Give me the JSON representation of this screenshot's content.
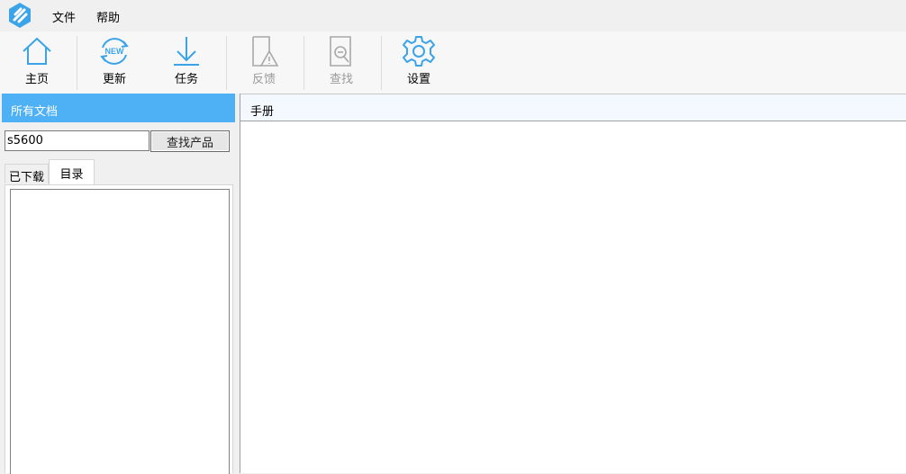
{
  "menu": {
    "items": [
      "文件",
      "帮助"
    ]
  },
  "toolbar": {
    "buttons": [
      {
        "label": "主页",
        "icon": "home-icon",
        "enabled": true
      },
      {
        "label": "更新",
        "icon": "new-update-icon",
        "badge": "NEW",
        "enabled": true
      },
      {
        "label": "任务",
        "icon": "download-arrow-icon",
        "enabled": true
      },
      {
        "label": "反馈",
        "icon": "feedback-warning-icon",
        "enabled": false
      },
      {
        "label": "查找",
        "icon": "search-document-icon",
        "enabled": false
      },
      {
        "label": "设置",
        "icon": "gear-icon",
        "enabled": true
      }
    ]
  },
  "left_panel": {
    "title": "所有文档",
    "search_value": "s5600",
    "find_button": "查找产品",
    "tabs": [
      {
        "label": "已下载",
        "active": false
      },
      {
        "label": "目录",
        "active": true
      }
    ]
  },
  "right_panel": {
    "title": "手册"
  },
  "colors": {
    "accent": "#4eb0f5",
    "icon_blue": "#3ba4e8",
    "disabled": "#9a9a9a"
  }
}
